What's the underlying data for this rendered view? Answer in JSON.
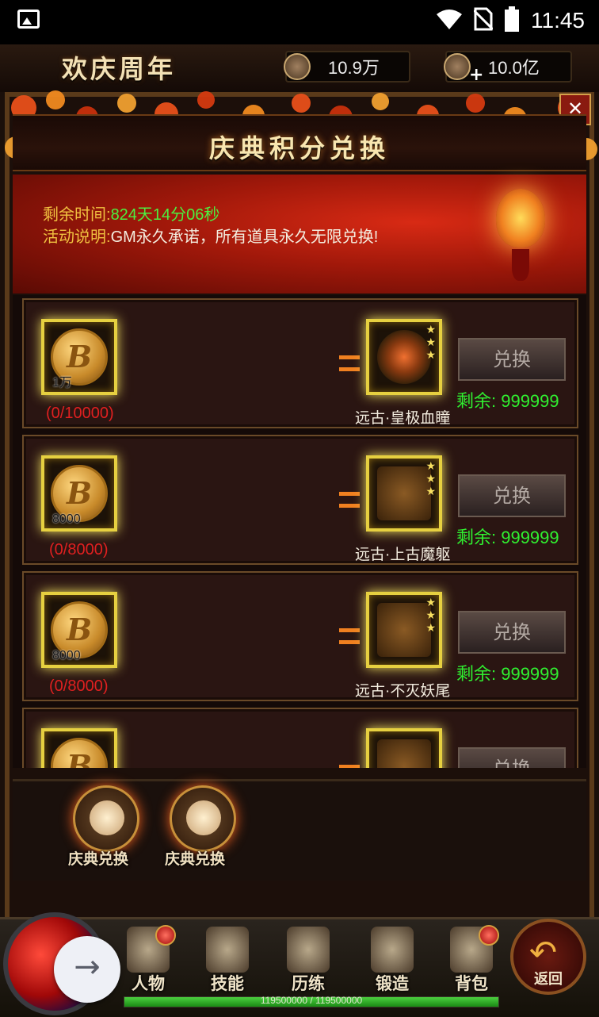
{
  "status_bar": {
    "time": "11:45",
    "icons": [
      "image-icon",
      "wifi-icon",
      "no-sim-icon",
      "battery-icon"
    ]
  },
  "top_bar": {
    "banner": "欢庆周年",
    "copper": "10.9万",
    "gold": "10.0亿"
  },
  "panel": {
    "title": "庆典积分兑换",
    "remaining_time_label": "剩余时间:",
    "remaining_time_value": "824天14分06秒",
    "description_label": "活动说明:",
    "description_value": "GM永久承诺，所有道具永久无限兑换!"
  },
  "exchange_items": [
    {
      "cost_qty": "1万",
      "progress": "(0/10000)",
      "reward_name": "远古·皇极血瞳",
      "button": "兑换",
      "remaining": "剩余: 999999"
    },
    {
      "cost_qty": "8000",
      "progress": "(0/8000)",
      "reward_name": "远古·上古魔躯",
      "button": "兑换",
      "remaining": "剩余: 999999"
    },
    {
      "cost_qty": "8000",
      "progress": "(0/8000)",
      "reward_name": "远古·不灭妖尾",
      "button": "兑换",
      "remaining": "剩余: 999999"
    },
    {
      "cost_qty": "",
      "progress": "",
      "reward_name": "",
      "button": "兑换",
      "remaining": ""
    }
  ],
  "tabs": [
    {
      "label": "庆典兑换"
    },
    {
      "label": "庆典兑换"
    }
  ],
  "bottom_nav": {
    "items": [
      "人物",
      "技能",
      "历练",
      "锻造",
      "背包"
    ],
    "back": "返回"
  },
  "exp": {
    "text": "119500000 / 119500000",
    "fraction": 1.0
  },
  "colors": {
    "green": "#4cf040",
    "red_text": "#e02020",
    "gold_label": "#f0c040"
  }
}
